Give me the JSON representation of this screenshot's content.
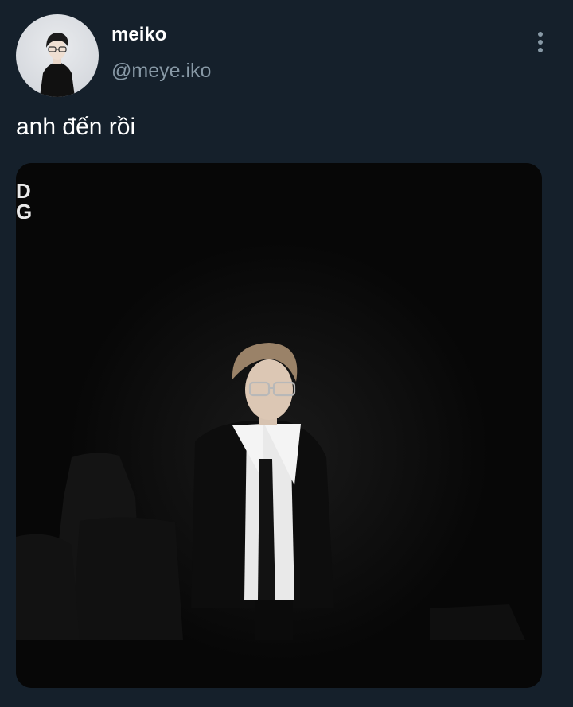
{
  "tweet": {
    "display_name": "meiko",
    "handle": "@meye.iko",
    "text": "anh đến rồi"
  },
  "media": {
    "corner_text": "D\nG"
  },
  "icons": {
    "more": "vertical-ellipsis-icon"
  },
  "colors": {
    "background": "#15202b",
    "primary_text": "#ffffff",
    "secondary_text": "#8899a6"
  }
}
